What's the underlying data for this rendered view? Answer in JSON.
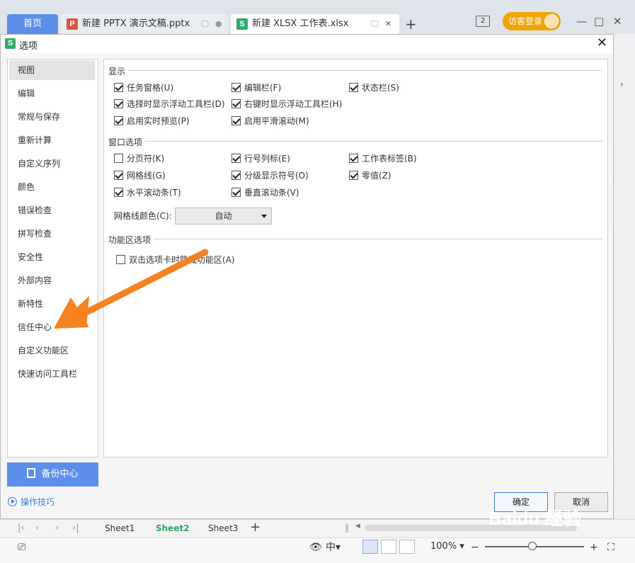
{
  "topbar": {
    "home_tab": "首页",
    "tabs": [
      {
        "label": "新建 PPTX 演示文稿.pptx",
        "badge": "P"
      },
      {
        "label": "新建 XLSX 工作表.xlsx",
        "badge": "S"
      }
    ],
    "add_tab": "+",
    "window_count": "2",
    "login_label": "访客登录",
    "minimize": "—",
    "maximize": "□",
    "close": "✕"
  },
  "dialog": {
    "title": "选项",
    "close": "✕",
    "nav_items": [
      "视图",
      "编辑",
      "常规与保存",
      "重新计算",
      "自定义序列",
      "颜色",
      "错误检查",
      "拼写检查",
      "安全性",
      "外部内容",
      "新特性",
      "信任中心",
      "自定义功能区",
      "快速访问工具栏"
    ],
    "active_nav": "视图",
    "sections": {
      "display": {
        "title": "显示",
        "options": [
          {
            "label": "任务窗格(U)",
            "checked": true
          },
          {
            "label": "编辑栏(F)",
            "checked": true
          },
          {
            "label": "状态栏(S)",
            "checked": true
          },
          {
            "label": "选择时显示浮动工具栏(D)",
            "checked": true
          },
          {
            "label": "右键时显示浮动工具栏(H)",
            "checked": true
          },
          {
            "label": "启用实时预览(P)",
            "checked": true
          },
          {
            "label": "启用平滑滚动(M)",
            "checked": true
          }
        ]
      },
      "window": {
        "title": "窗口选项",
        "options": [
          {
            "label": "分页符(K)",
            "checked": false
          },
          {
            "label": "行号列标(E)",
            "checked": true
          },
          {
            "label": "工作表标签(B)",
            "checked": true
          },
          {
            "label": "网格线(G)",
            "checked": true
          },
          {
            "label": "分级显示符号(O)",
            "checked": true
          },
          {
            "label": "零值(Z)",
            "checked": true
          },
          {
            "label": "水平滚动条(T)",
            "checked": true
          },
          {
            "label": "垂直滚动条(V)",
            "checked": true
          }
        ],
        "grid_color_label": "网格线颜色(C):",
        "grid_color_value": "自动"
      },
      "ribbon": {
        "title": "功能区选项",
        "options": [
          {
            "label": "双击选项卡时隐藏功能区(A)",
            "checked": false
          }
        ]
      }
    },
    "backup_label": "备份中心",
    "tips_label": "操作技巧",
    "ok_label": "确定",
    "cancel_label": "取消"
  },
  "sheetbar": {
    "sheets": [
      "Sheet1",
      "Sheet2",
      "Sheet3"
    ],
    "active_sheet": "Sheet2",
    "add": "+"
  },
  "statusbar": {
    "zoom": "100%",
    "zoom_minus": "−",
    "zoom_plus": "+"
  },
  "watermark": "Baidu 经验",
  "colors": {
    "accent": "#5b8fea",
    "sheet_active": "#2fa86b",
    "login": "#f0a500",
    "arrow": "#f58220"
  }
}
